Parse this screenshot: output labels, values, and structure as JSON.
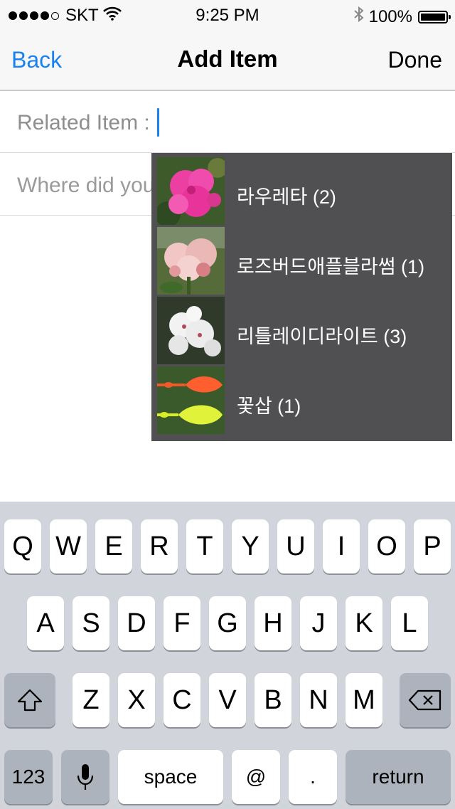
{
  "status_bar": {
    "carrier": "SKT",
    "time": "9:25 PM",
    "battery_percent": "100%",
    "signal_bars_filled": 4,
    "signal_bars_total": 5,
    "icons": [
      "signal-dots-icon",
      "wifi-icon",
      "bluetooth-icon",
      "battery-icon"
    ]
  },
  "nav": {
    "back": "Back",
    "title": "Add Item",
    "done": "Done"
  },
  "form": {
    "related_label": "Related Item :",
    "related_value": "",
    "where_placeholder": "Where did you … (optional)"
  },
  "suggestions": [
    {
      "label": "라우레타 (2)",
      "thumb_icon": "pink-flower-photo"
    },
    {
      "label": "로즈버드애플블라썸 (1)",
      "thumb_icon": "rosebud-flower-photo"
    },
    {
      "label": "리틀레이디라이트 (3)",
      "thumb_icon": "white-flower-photo"
    },
    {
      "label": "꽃삽 (1)",
      "thumb_icon": "trowel-photo"
    }
  ],
  "keyboard": {
    "row1": [
      "Q",
      "W",
      "E",
      "R",
      "T",
      "Y",
      "U",
      "I",
      "O",
      "P"
    ],
    "row2": [
      "A",
      "S",
      "D",
      "F",
      "G",
      "H",
      "J",
      "K",
      "L"
    ],
    "row3": [
      "Z",
      "X",
      "C",
      "V",
      "B",
      "N",
      "M"
    ],
    "numbers_key": "123",
    "space_key": "space",
    "at_key": "@",
    "period_key": ".",
    "return_key": "return",
    "icons": [
      "shift-icon",
      "backspace-icon",
      "microphone-icon"
    ]
  },
  "colors": {
    "accent": "#1a82f0",
    "popup_bg": "#505052",
    "keyboard_bg": "#d1d5db",
    "dark_key": "#acb3bc"
  }
}
